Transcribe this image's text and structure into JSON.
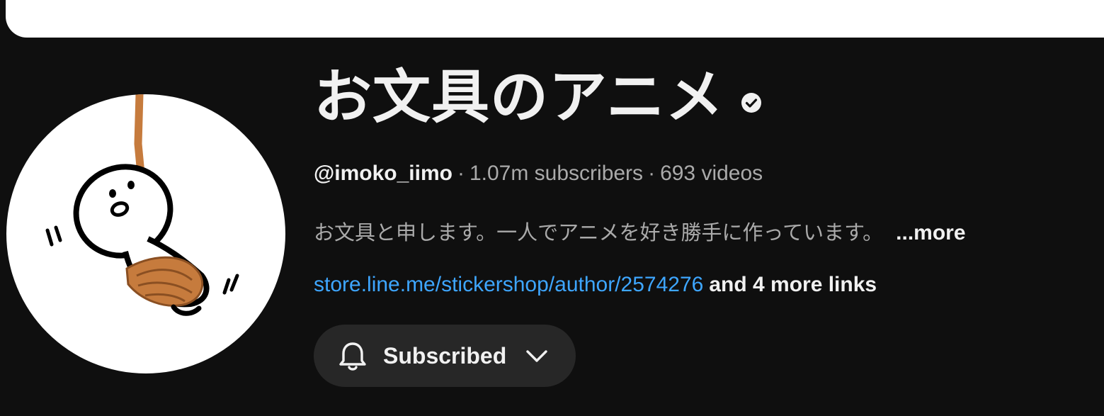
{
  "channel": {
    "name": "お文具のアニメ",
    "handle": "@imoko_iimo",
    "subscribers": "1.07m subscribers",
    "videos": "693 videos",
    "separator": "·",
    "description": "お文具と申します。一人でアニメを好き勝手に作っています。",
    "more_label": "...more",
    "link_text": "store.line.me/stickershop/author/2574276",
    "more_links_label": "and 4 more links",
    "verified_icon": "verified-check-icon"
  },
  "subscribe": {
    "label": "Subscribed",
    "bell_icon": "bell-icon",
    "chevron_icon": "chevron-down-icon"
  },
  "colors": {
    "background": "#0f0f0f",
    "text_primary": "#f1f1f1",
    "text_secondary": "#aaaaaa",
    "link": "#3ea6ff",
    "button_bg": "#272727"
  }
}
